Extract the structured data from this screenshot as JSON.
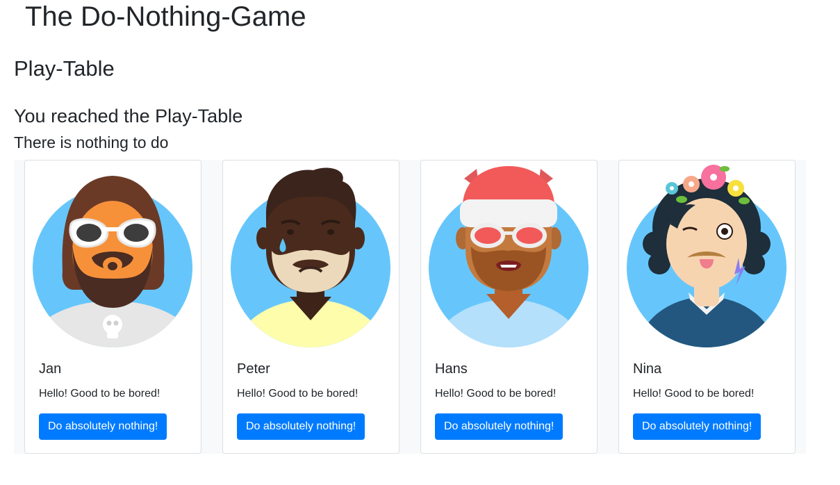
{
  "app": {
    "title": "The Do-Nothing-Game"
  },
  "page": {
    "title": "Play-Table",
    "heading": "You reached the Play-Table",
    "subheading": "There is nothing to do"
  },
  "players": [
    {
      "name": "Jan",
      "greeting": "Hello! Good to be bored!",
      "button_label": "Do absolutely nothing!",
      "avatar_icon": "bearded-sunglasses-avatar-icon"
    },
    {
      "name": "Peter",
      "greeting": "Hello! Good to be bored!",
      "button_label": "Do absolutely nothing!",
      "avatar_icon": "crying-man-avatar-icon"
    },
    {
      "name": "Hans",
      "greeting": "Hello! Good to be bored!",
      "button_label": "Do absolutely nothing!",
      "avatar_icon": "santa-hat-avatar-icon"
    },
    {
      "name": "Nina",
      "greeting": "Hello! Good to be bored!",
      "button_label": "Do absolutely nothing!",
      "avatar_icon": "flower-crown-avatar-icon"
    }
  ],
  "colors": {
    "primary": "#007bff",
    "avatar_background": "#66c6fb",
    "table_background": "#f8f9fa"
  }
}
